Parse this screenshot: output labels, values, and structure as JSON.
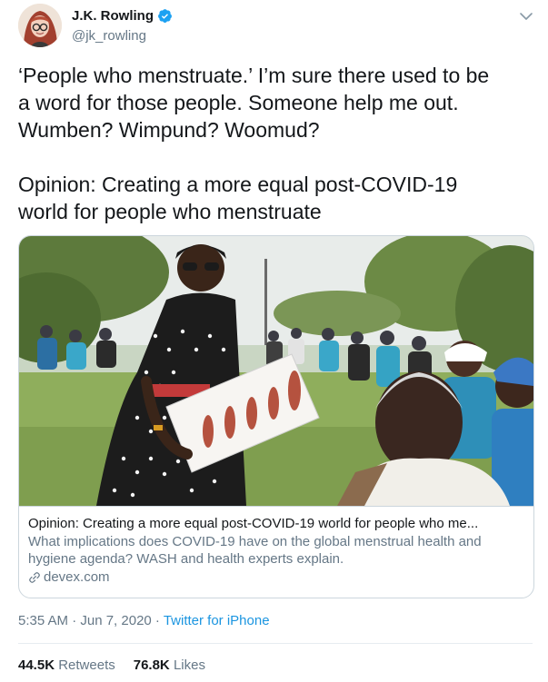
{
  "author": {
    "name": "J.K. Rowling",
    "handle": "@jk_rowling",
    "verified": true,
    "avatar_icon": "author-avatar"
  },
  "tweet": {
    "text": "‘People who menstruate.’ I’m sure there used to be\na word for those people. Someone help me out.\nWumben? Wimpund? Woomud?\n\nOpinion: Creating a more equal post-COVID-19\nworld for people who menstruate"
  },
  "card": {
    "title": "Opinion: Creating a more equal post-COVID-19 world for people who me...",
    "description": "What implications does COVID-19 have on the global menstrual health and hygiene agenda? WASH and health experts explain.",
    "domain": "devex.com",
    "domain_icon": "link-icon"
  },
  "meta": {
    "time": "5:35 AM · Jun 7, 2020 · ",
    "source": "Twitter for iPhone"
  },
  "stats": {
    "retweets_count": "44.5K",
    "retweets_label": "Retweets",
    "likes_count": "76.8K",
    "likes_label": "Likes"
  },
  "colors": {
    "link": "#1b95e0",
    "secondary_text": "#657786",
    "border": "#ccd6dd",
    "verified": "#1da1f2"
  }
}
